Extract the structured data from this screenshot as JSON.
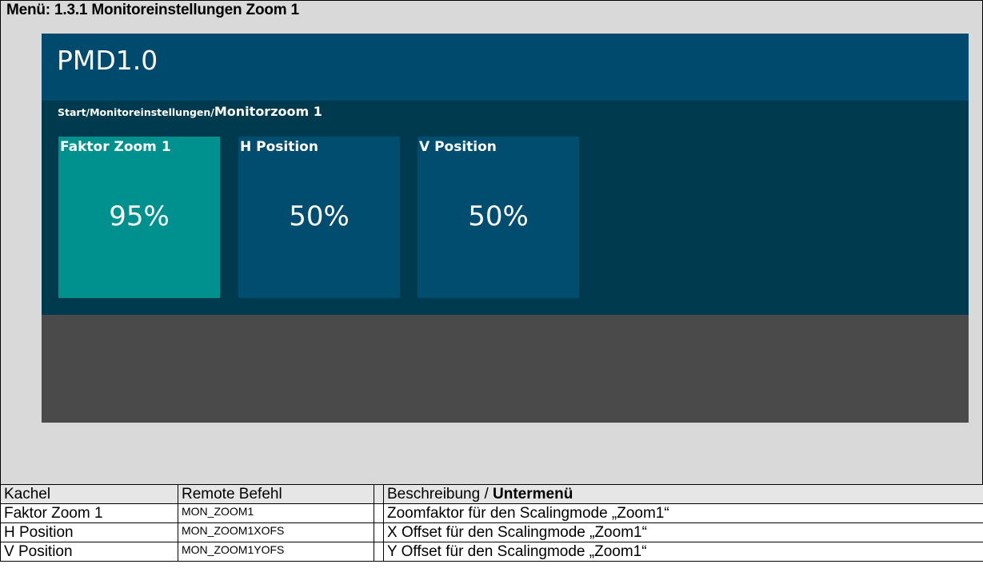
{
  "menu": {
    "title": "Menü: 1.3.1  Monitoreinstellungen Zoom 1"
  },
  "app": {
    "title": "PMD1.0",
    "breadcrumb_path": "Start/Monitoreinstellungen/",
    "breadcrumb_current": "Monitorzoom 1"
  },
  "tiles": [
    {
      "label": "Faktor Zoom 1",
      "value": "95%",
      "active": true
    },
    {
      "label": "H Position",
      "value": "50%",
      "active": false
    },
    {
      "label": "V Position",
      "value": "50%",
      "active": false
    }
  ],
  "colors": {
    "header": "#004a6e",
    "content": "#003a4e",
    "tile_active": "#00908e",
    "tile_default": "#004d70",
    "screen_bottom": "#4a4a4a"
  },
  "table": {
    "headers": {
      "kachel": "Kachel",
      "remote": "Remote Befehl",
      "beschreibung": "Beschreibung / ",
      "untermenu": "Untermenü"
    },
    "rows": [
      {
        "kachel": "Faktor Zoom 1",
        "remote": "MON_ZOOM1",
        "beschreibung": "Zoomfaktor für den Scalingmode „Zoom1“"
      },
      {
        "kachel": "H Position",
        "remote": "MON_ZOOM1XOFS",
        "beschreibung": "X Offset für den Scalingmode „Zoom1“"
      },
      {
        "kachel": "V Position",
        "remote": "MON_ZOOM1YOFS",
        "beschreibung": "Y Offset für den Scalingmode „Zoom1“"
      }
    ]
  }
}
